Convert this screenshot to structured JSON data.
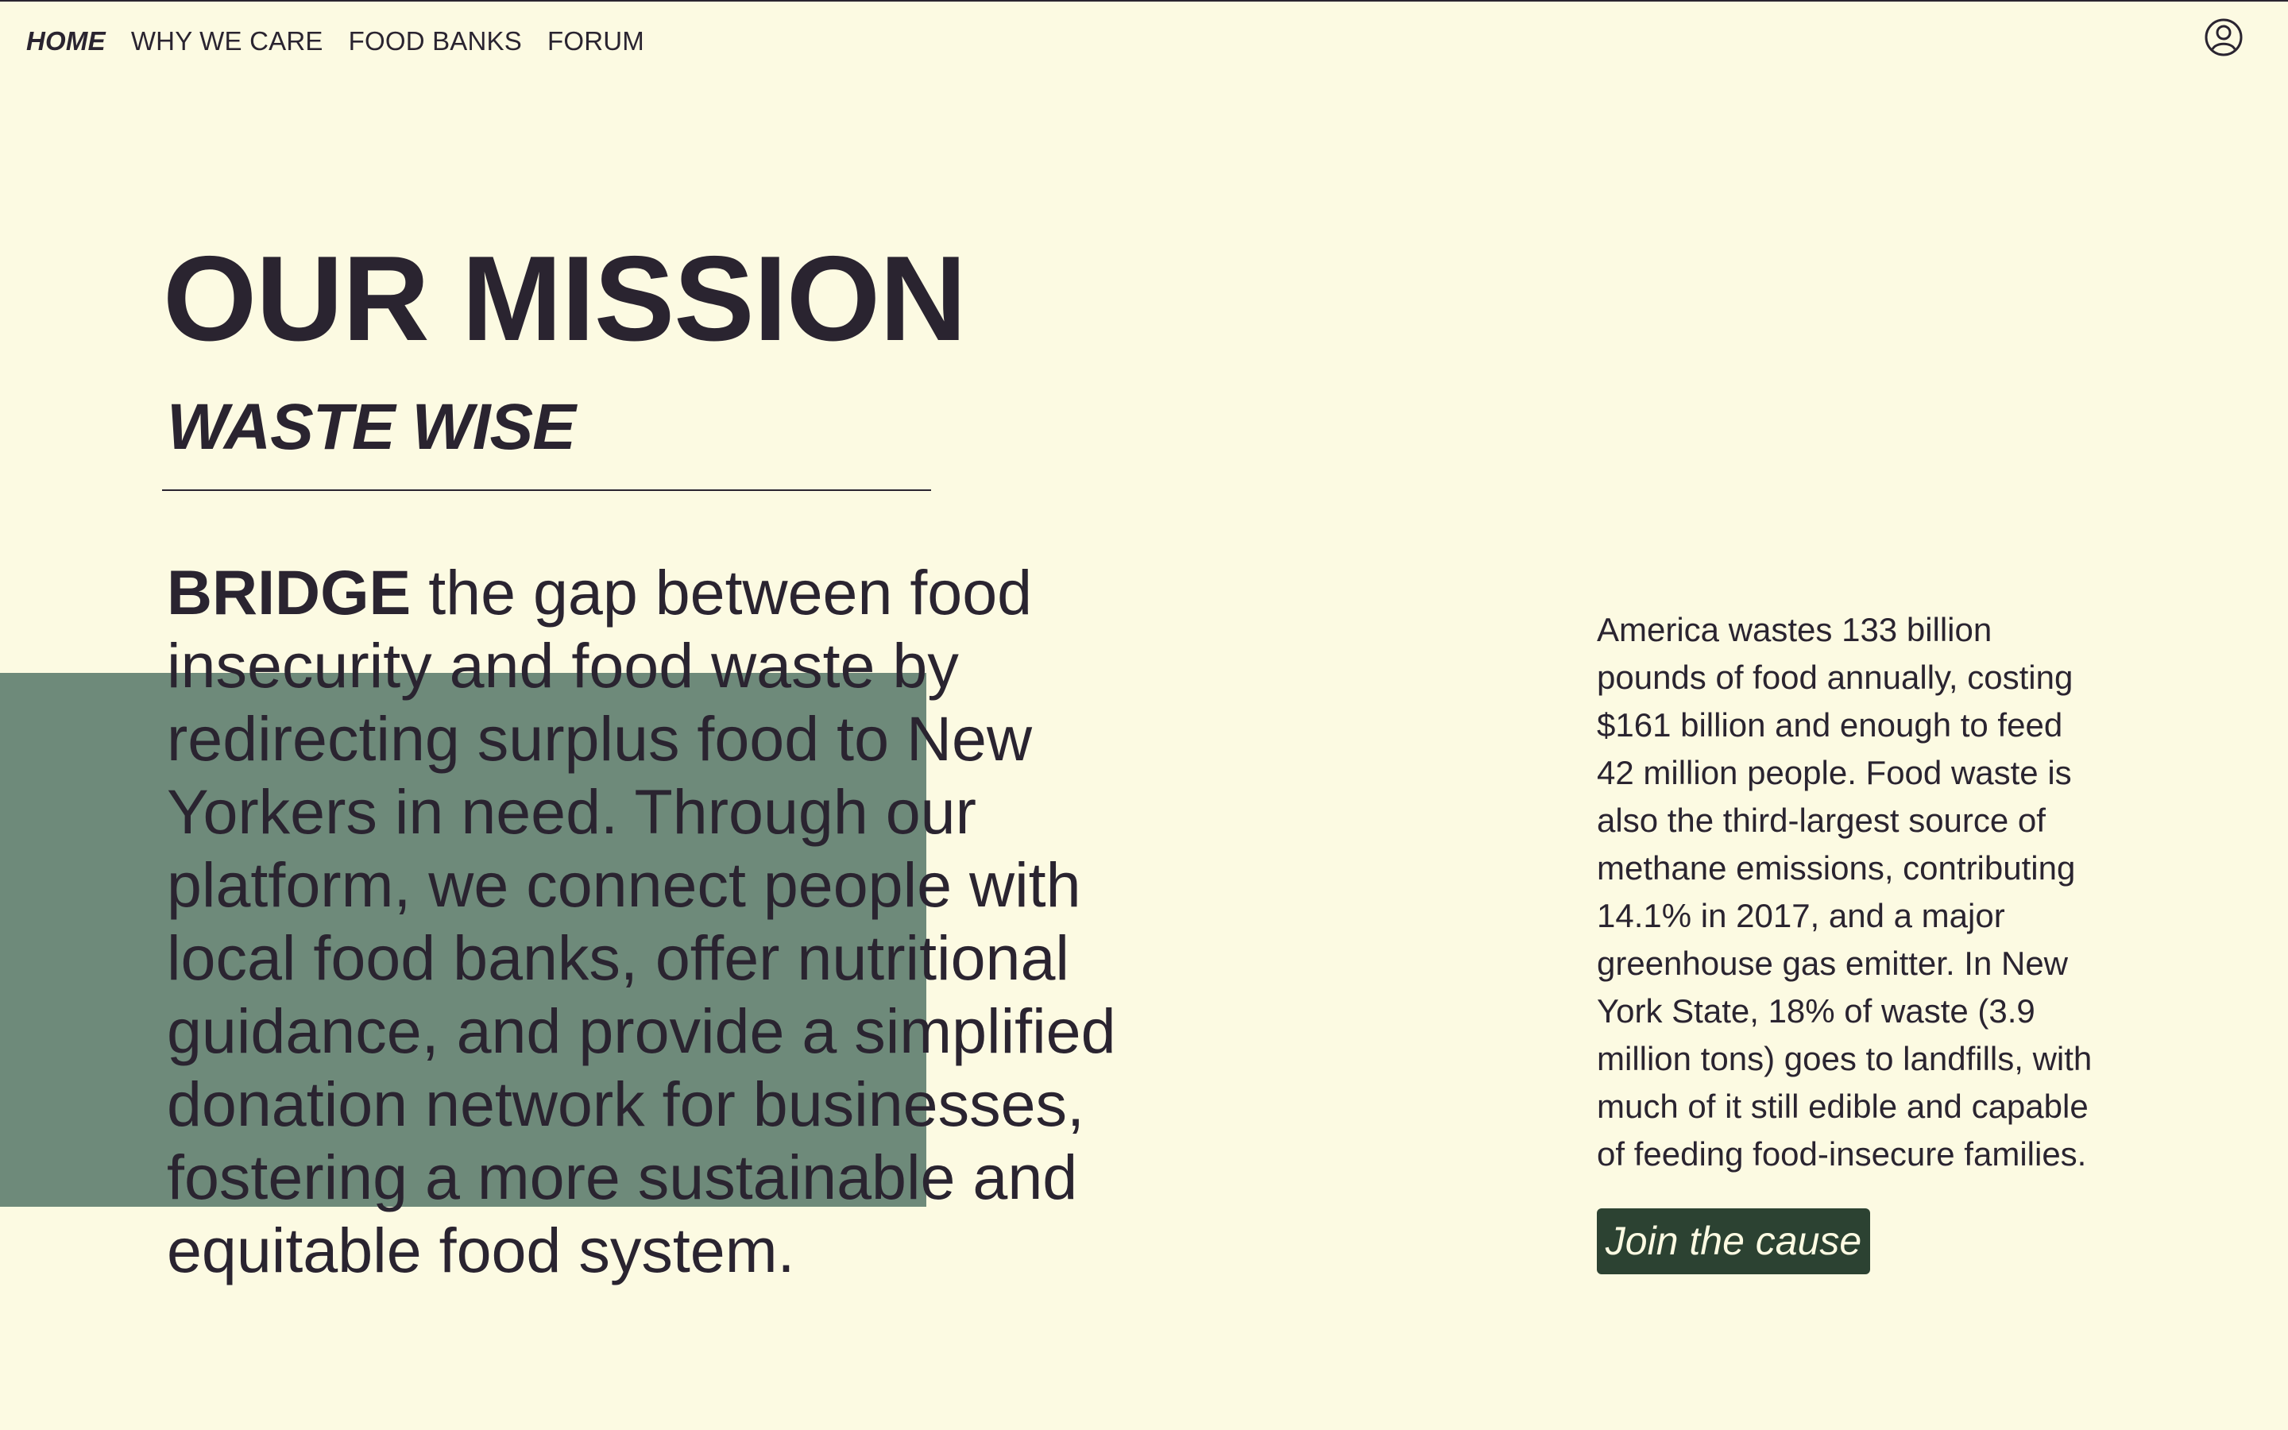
{
  "nav": {
    "items": [
      {
        "label": "HOME"
      },
      {
        "label": "WHY WE CARE"
      },
      {
        "label": "FOOD BANKS"
      },
      {
        "label": "FORUM"
      }
    ],
    "account_icon": "user-circle-icon"
  },
  "hero": {
    "title": "OUR MISSION",
    "subtitle": "WASTE WISE",
    "lead_bold": "BRIDGE",
    "lines": [
      " the gap between food",
      "insecurity and food waste by",
      "redirecting surplus food to New",
      "Yorkers in need. Through our",
      "platform, we connect people with",
      "local food banks, offer nutritional",
      "guidance, and provide a simplified",
      "donation network for businesses,",
      "fostering a more sustainable and",
      "equitable food system."
    ]
  },
  "facts": {
    "lines": [
      "America wastes 133 billion",
      "pounds of food annually, costing",
      "$161 billion and enough to feed",
      "42 million people. Food waste is",
      "also the third-largest source of",
      "methane emissions, contributing",
      "14.1% in 2017, and a major",
      "greenhouse gas emitter. In New",
      "York State, 18% of waste (3.9",
      "million tons) goes to landfills, with",
      "much of it still edible and capable",
      "of feeding food-insecure families."
    ]
  },
  "cta": {
    "label": "Join the cause"
  },
  "colors": {
    "background": "#fcfae2",
    "text": "#2a2430",
    "accent_block": "#6e8a7a",
    "button": "#2c4232"
  }
}
